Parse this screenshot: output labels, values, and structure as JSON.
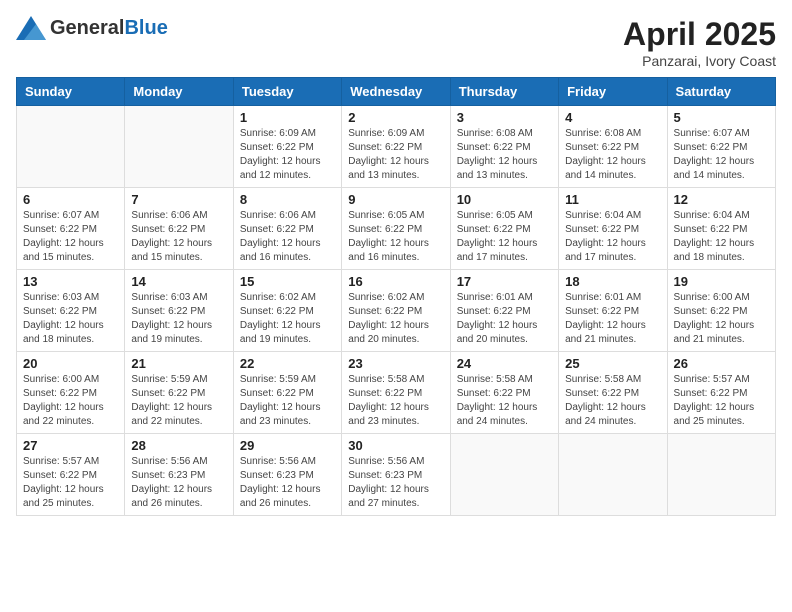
{
  "header": {
    "logo_general": "General",
    "logo_blue": "Blue",
    "title": "April 2025",
    "subtitle": "Panzarai, Ivory Coast"
  },
  "days_of_week": [
    "Sunday",
    "Monday",
    "Tuesday",
    "Wednesday",
    "Thursday",
    "Friday",
    "Saturday"
  ],
  "weeks": [
    [
      {
        "day": "",
        "info": ""
      },
      {
        "day": "",
        "info": ""
      },
      {
        "day": "1",
        "info": "Sunrise: 6:09 AM\nSunset: 6:22 PM\nDaylight: 12 hours and 12 minutes."
      },
      {
        "day": "2",
        "info": "Sunrise: 6:09 AM\nSunset: 6:22 PM\nDaylight: 12 hours and 13 minutes."
      },
      {
        "day": "3",
        "info": "Sunrise: 6:08 AM\nSunset: 6:22 PM\nDaylight: 12 hours and 13 minutes."
      },
      {
        "day": "4",
        "info": "Sunrise: 6:08 AM\nSunset: 6:22 PM\nDaylight: 12 hours and 14 minutes."
      },
      {
        "day": "5",
        "info": "Sunrise: 6:07 AM\nSunset: 6:22 PM\nDaylight: 12 hours and 14 minutes."
      }
    ],
    [
      {
        "day": "6",
        "info": "Sunrise: 6:07 AM\nSunset: 6:22 PM\nDaylight: 12 hours and 15 minutes."
      },
      {
        "day": "7",
        "info": "Sunrise: 6:06 AM\nSunset: 6:22 PM\nDaylight: 12 hours and 15 minutes."
      },
      {
        "day": "8",
        "info": "Sunrise: 6:06 AM\nSunset: 6:22 PM\nDaylight: 12 hours and 16 minutes."
      },
      {
        "day": "9",
        "info": "Sunrise: 6:05 AM\nSunset: 6:22 PM\nDaylight: 12 hours and 16 minutes."
      },
      {
        "day": "10",
        "info": "Sunrise: 6:05 AM\nSunset: 6:22 PM\nDaylight: 12 hours and 17 minutes."
      },
      {
        "day": "11",
        "info": "Sunrise: 6:04 AM\nSunset: 6:22 PM\nDaylight: 12 hours and 17 minutes."
      },
      {
        "day": "12",
        "info": "Sunrise: 6:04 AM\nSunset: 6:22 PM\nDaylight: 12 hours and 18 minutes."
      }
    ],
    [
      {
        "day": "13",
        "info": "Sunrise: 6:03 AM\nSunset: 6:22 PM\nDaylight: 12 hours and 18 minutes."
      },
      {
        "day": "14",
        "info": "Sunrise: 6:03 AM\nSunset: 6:22 PM\nDaylight: 12 hours and 19 minutes."
      },
      {
        "day": "15",
        "info": "Sunrise: 6:02 AM\nSunset: 6:22 PM\nDaylight: 12 hours and 19 minutes."
      },
      {
        "day": "16",
        "info": "Sunrise: 6:02 AM\nSunset: 6:22 PM\nDaylight: 12 hours and 20 minutes."
      },
      {
        "day": "17",
        "info": "Sunrise: 6:01 AM\nSunset: 6:22 PM\nDaylight: 12 hours and 20 minutes."
      },
      {
        "day": "18",
        "info": "Sunrise: 6:01 AM\nSunset: 6:22 PM\nDaylight: 12 hours and 21 minutes."
      },
      {
        "day": "19",
        "info": "Sunrise: 6:00 AM\nSunset: 6:22 PM\nDaylight: 12 hours and 21 minutes."
      }
    ],
    [
      {
        "day": "20",
        "info": "Sunrise: 6:00 AM\nSunset: 6:22 PM\nDaylight: 12 hours and 22 minutes."
      },
      {
        "day": "21",
        "info": "Sunrise: 5:59 AM\nSunset: 6:22 PM\nDaylight: 12 hours and 22 minutes."
      },
      {
        "day": "22",
        "info": "Sunrise: 5:59 AM\nSunset: 6:22 PM\nDaylight: 12 hours and 23 minutes."
      },
      {
        "day": "23",
        "info": "Sunrise: 5:58 AM\nSunset: 6:22 PM\nDaylight: 12 hours and 23 minutes."
      },
      {
        "day": "24",
        "info": "Sunrise: 5:58 AM\nSunset: 6:22 PM\nDaylight: 12 hours and 24 minutes."
      },
      {
        "day": "25",
        "info": "Sunrise: 5:58 AM\nSunset: 6:22 PM\nDaylight: 12 hours and 24 minutes."
      },
      {
        "day": "26",
        "info": "Sunrise: 5:57 AM\nSunset: 6:22 PM\nDaylight: 12 hours and 25 minutes."
      }
    ],
    [
      {
        "day": "27",
        "info": "Sunrise: 5:57 AM\nSunset: 6:22 PM\nDaylight: 12 hours and 25 minutes."
      },
      {
        "day": "28",
        "info": "Sunrise: 5:56 AM\nSunset: 6:23 PM\nDaylight: 12 hours and 26 minutes."
      },
      {
        "day": "29",
        "info": "Sunrise: 5:56 AM\nSunset: 6:23 PM\nDaylight: 12 hours and 26 minutes."
      },
      {
        "day": "30",
        "info": "Sunrise: 5:56 AM\nSunset: 6:23 PM\nDaylight: 12 hours and 27 minutes."
      },
      {
        "day": "",
        "info": ""
      },
      {
        "day": "",
        "info": ""
      },
      {
        "day": "",
        "info": ""
      }
    ]
  ]
}
